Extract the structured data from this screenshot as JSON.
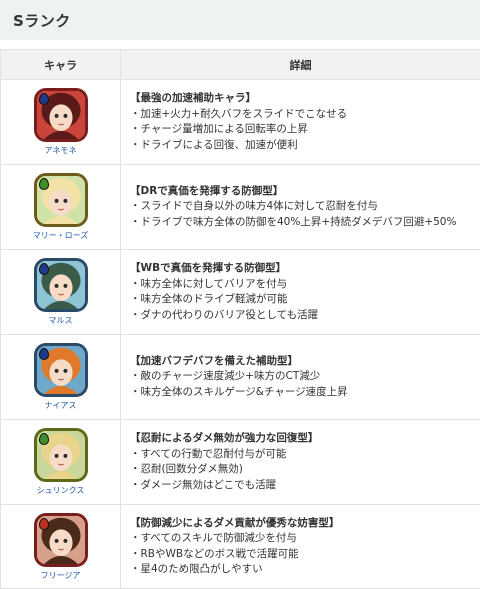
{
  "section": {
    "title": "Sランク"
  },
  "table": {
    "headers": [
      "キャラ",
      "詳細"
    ],
    "rows": [
      {
        "name": "アネモネ",
        "frame": "#7a1d1d",
        "bg": "#c9443a",
        "hair": "#5a1a1a",
        "elem": "#1f3a8a",
        "title": "【最強の加速補助キャラ】",
        "points": [
          "加速+火力+耐久バフをスライドでこなせる",
          "チャージ量増加による回転率の上昇",
          "ドライブによる回復、加速が便利"
        ]
      },
      {
        "name": "マリー・ローズ",
        "frame": "#6b5a1a",
        "bg": "#cfe3a8",
        "hair": "#f3e2a6",
        "elem": "#3f8f2a",
        "title": "【DRで真価を発揮する防御型】",
        "points": [
          "スライドで自身以外の味方4体に対して忍耐を付与",
          "ドライブで味方全体の防御を40%上昇+持続ダメデバフ回避+50%"
        ]
      },
      {
        "name": "マルス",
        "frame": "#2a4a6a",
        "bg": "#8fc3d6",
        "hair": "#3a5a4a",
        "elem": "#1f3a8a",
        "title": "【WBで真価を発揮する防御型】",
        "points": [
          "味方全体に対してバリアを付与",
          "味方全体のドライブ軽減が可能",
          "ダナの代わりのバリア役としても活躍"
        ]
      },
      {
        "name": "ナイアス",
        "frame": "#2a4a6a",
        "bg": "#6fa8c8",
        "hair": "#e07a2a",
        "elem": "#1f3a8a",
        "title": "【加速バフデバフを備えた補助型】",
        "points": [
          "敵のチャージ速度減少+味方のCT減少",
          "味方全体のスキルゲージ&チャージ速度上昇"
        ]
      },
      {
        "name": "シュリンクス",
        "frame": "#5a6a1a",
        "bg": "#c8d89a",
        "hair": "#e8d48a",
        "elem": "#3f8f2a",
        "title": "【忍耐によるダメ無効が強力な回復型】",
        "points": [
          "すべての行動で忍耐付与が可能",
          "忍耐(回数分ダメ無効)",
          "ダメージ無効はどこでも活躍"
        ]
      },
      {
        "name": "フリージア",
        "frame": "#7a1d1d",
        "bg": "#d6a08a",
        "hair": "#4a2a1a",
        "elem": "#c0301f",
        "title": "【防御減少によるダメ貢献が優秀な妨害型】",
        "points": [
          "すべてのスキルで防御減少を付与",
          "RBやWBなどのボス戦で活躍可能",
          "星4のため限凸がしやすい"
        ]
      }
    ]
  }
}
